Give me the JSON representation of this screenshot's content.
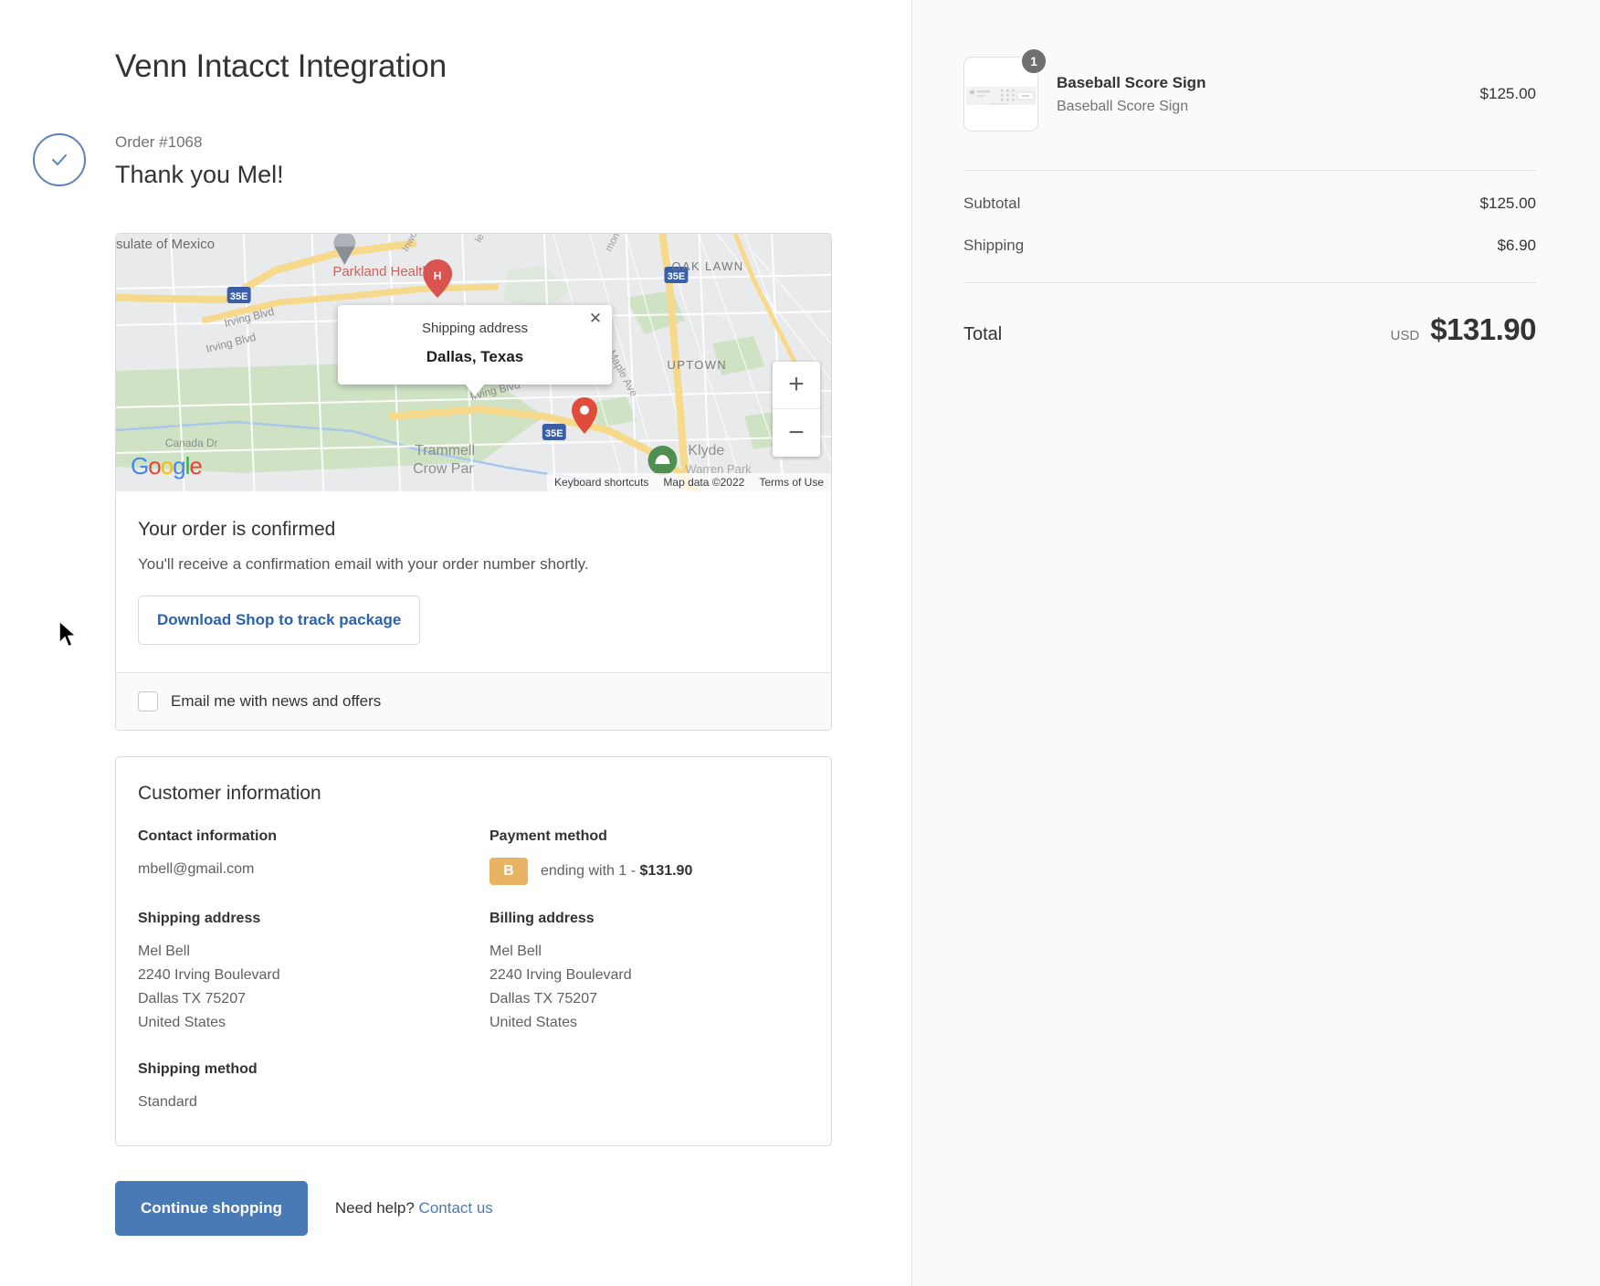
{
  "shop": {
    "title": "Venn Intacct Integration"
  },
  "confirmation": {
    "order_number": "Order #1068",
    "thank_you": "Thank you Mel!",
    "check_icon": "check-circle-icon"
  },
  "map": {
    "popup_label": "Shipping address",
    "popup_city": "Dallas, Texas",
    "close_icon": "close-icon",
    "zoom_in": "+",
    "zoom_out": "−",
    "logo_letters": [
      "G",
      "o",
      "o",
      "g",
      "l",
      "e"
    ],
    "attribution": [
      "Keyboard shortcuts",
      "Map data ©2022",
      "Terms of Use"
    ],
    "labels": [
      "sulate of Mexico",
      "Parkland Health",
      "Inwood",
      "Maple Ave",
      "Harmon Ave",
      "OAK LAWN",
      "UPTOWN",
      "Irving Blvd",
      "Maple Ave",
      "Canada Dr",
      "Trammell",
      "Crow Par",
      "Klyde",
      "Irving Blvd",
      "Inwood Rd",
      "35E",
      "35E",
      "35E"
    ]
  },
  "order_status": {
    "heading": "Your order is confirmed",
    "subtext": "You'll receive a confirmation email with your order number shortly.",
    "download_button": "Download Shop to track package",
    "newsletter_label": "Email me with news and offers",
    "newsletter_checked": false
  },
  "customer": {
    "heading": "Customer information",
    "contact_heading": "Contact information",
    "contact_email": "mbell@gmail.com",
    "payment_heading": "Payment method",
    "payment_badge": "B",
    "payment_text_prefix": "ending with 1 - ",
    "payment_amount": "$131.90",
    "shipping_heading": "Shipping address",
    "shipping_address": "Mel Bell\n2240 Irving Boulevard\nDallas TX 75207\nUnited States",
    "billing_heading": "Billing address",
    "billing_address": "Mel Bell\n2240 Irving Boulevard\nDallas TX 75207\nUnited States",
    "shipping_method_heading": "Shipping method",
    "shipping_method": "Standard"
  },
  "actions": {
    "continue_shopping": "Continue shopping",
    "help_text": "Need help? ",
    "contact_link": "Contact us"
  },
  "summary": {
    "items": [
      {
        "title": "Baseball Score Sign",
        "variant": "Baseball Score Sign",
        "price": "$125.00",
        "quantity": "1"
      }
    ],
    "rows": [
      {
        "label": "Subtotal",
        "value": "$125.00"
      },
      {
        "label": "Shipping",
        "value": "$6.90"
      }
    ],
    "total_label": "Total",
    "total_currency": "USD",
    "total_value": "$131.90"
  },
  "colors": {
    "accent": "#4a7ab5",
    "link": "#2b62b0",
    "badge": "#e8b463",
    "panel": "#fafafa"
  }
}
